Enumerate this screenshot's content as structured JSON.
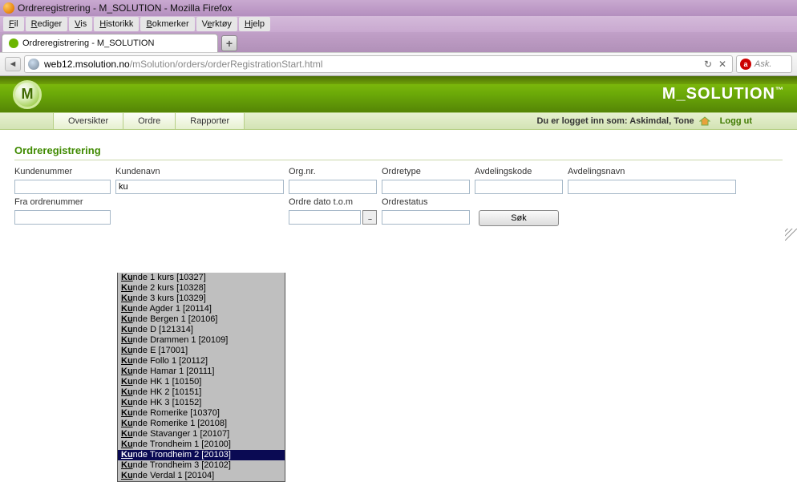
{
  "browser": {
    "window_title": "Ordreregistrering - M_SOLUTION - Mozilla Firefox",
    "menu": [
      "Fil",
      "Rediger",
      "Vis",
      "Historikk",
      "Bokmerker",
      "Verktøy",
      "Hjelp"
    ],
    "tab_title": "Ordreregistrering - M_SOLUTION",
    "newtab_glyph": "+",
    "back_glyph": "◄",
    "url_host": "web12.msolution.no",
    "url_path": "/mSolution/orders/orderRegistrationStart.html",
    "reload_glyph": "↻",
    "search_placeholder": "Ask."
  },
  "app": {
    "logo_letter": "M",
    "brand": "M_SOLUTION",
    "brand_tm": "™",
    "tabs": [
      "Oversikter",
      "Ordre",
      "Rapporter"
    ],
    "login_prefix": "Du er logget inn som: ",
    "login_user": "Askimdal, Tone",
    "logout": "Logg ut"
  },
  "panel": {
    "title": "Ordreregistrering",
    "labels": {
      "kundenummer": "Kundenummer",
      "kundenavn": "Kundenavn",
      "orgnr": "Org.nr.",
      "ordretype": "Ordretype",
      "avdelingskode": "Avdelingskode",
      "avdelingsnavn": "Avdelingsnavn",
      "fra_ordrenummer": "Fra ordrenummer",
      "ordre_dato_tom": "Ordre dato t.o.m",
      "ordrestatus": "Ordrestatus"
    },
    "values": {
      "kundenavn": "ku"
    },
    "datepicker_glyph": "...",
    "search_btn": "Søk"
  },
  "autocomplete": {
    "prefix": "Ku",
    "selected_index": 17,
    "items": [
      "nde 1 kurs [10327]",
      "nde 2 kurs [10328]",
      "nde 3 kurs [10329]",
      "nde Agder 1 [20114]",
      "nde Bergen 1 [20106]",
      "nde D [121314]",
      "nde Drammen 1 [20109]",
      "nde E [17001]",
      "nde Follo 1 [20112]",
      "nde Hamar 1 [20111]",
      "nde HK 1 [10150]",
      "nde HK 2 [10151]",
      "nde HK 3 [10152]",
      "nde Romerike [10370]",
      "nde Romerike 1 [20108]",
      "nde Stavanger 1 [20107]",
      "nde Trondheim 1 [20100]",
      "nde Trondheim 2 [20103]",
      "nde Trondheim 3 [20102]",
      "nde Verdal 1 [20104]"
    ]
  }
}
